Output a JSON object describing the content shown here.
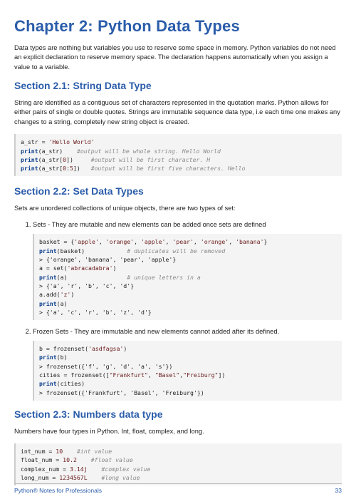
{
  "chapter_title": "Chapter 2: Python Data Types",
  "intro_text": "Data types are nothing but variables you use to reserve some space in memory. Python variables do not need an explicit declaration to reserve memory space. The declaration happens automatically when you assign a value to a variable.",
  "sections": {
    "s21": {
      "title": "Section 2.1: String Data Type",
      "text": "String are identified as a contiguous set of characters represented in the quotation marks. Python allows for either pairs of single or double quotes. Strings are immutable sequence data type, i.e each time one makes any changes to a string, completely new string object is created.",
      "code": {
        "l1a": "a_str = ",
        "l1b": "'Hello World'",
        "l2a": "print",
        "l2b": "(a_str)    ",
        "l2c": "#output will be whole string. Hello World",
        "l3a": "print",
        "l3b": "(a_str[",
        "l3c": "0",
        "l3d": "])     ",
        "l3e": "#output will be first character. H",
        "l4a": "print",
        "l4b": "(a_str[",
        "l4c": "0",
        "l4d": ":",
        "l4e": "5",
        "l4f": "])   ",
        "l4g": "#output will be first five characters. Hello"
      }
    },
    "s22": {
      "title": "Section 2.2: Set Data Types",
      "text": "Sets are unordered collections of unique objects, there are two types of set:",
      "item1_text": "Sets - They are mutable and new elements can be added once sets are defined",
      "item1_code": {
        "l1a": "basket = {",
        "l1b": "'apple'",
        "l1c": ", ",
        "l1d": "'orange'",
        "l1e": ", ",
        "l1f": "'apple'",
        "l1g": ", ",
        "l1h": "'pear'",
        "l1i": ", ",
        "l1j": "'orange'",
        "l1k": ", ",
        "l1l": "'banana'",
        "l1m": "}",
        "l2a": "print",
        "l2b": "(basket)            ",
        "l2c": "# duplicates will be removed",
        "l3": "> {'orange', 'banana', 'pear', 'apple'}",
        "l4a": "a = set(",
        "l4b": "'abracadabra'",
        "l4c": ")",
        "l5a": "print",
        "l5b": "(a)                 ",
        "l5c": "# unique letters in a",
        "l6": "> {'a', 'r', 'b', 'c', 'd'}",
        "l7a": "a.add(",
        "l7b": "'z'",
        "l7c": ")",
        "l8a": "print",
        "l8b": "(a)",
        "l9": "> {'a', 'c', 'r', 'b', 'z', 'd'}"
      },
      "item2_text": "Frozen Sets - They are immutable and new elements cannot added after its defined.",
      "item2_code": {
        "l1a": "b = frozenset(",
        "l1b": "'asdfagsa'",
        "l1c": ")",
        "l2a": "print",
        "l2b": "(b)",
        "l3": "> frozenset({'f', 'g', 'd', 'a', 's'})",
        "l4a": "cities = frozenset([",
        "l4b": "\"Frankfurt\"",
        "l4c": ", ",
        "l4d": "\"Basel\"",
        "l4e": ",",
        "l4f": "\"Freiburg\"",
        "l4g": "])",
        "l5a": "print",
        "l5b": "(cities)",
        "l6": "> frozenset({'Frankfurt', 'Basel', 'Freiburg'})"
      }
    },
    "s23": {
      "title": "Section 2.3: Numbers data type",
      "text": "Numbers have four types in Python. Int, float, complex, and long.",
      "code": {
        "l1a": "int_num = ",
        "l1b": "10",
        "l1c": "    ",
        "l1d": "#int value",
        "l2a": "float_num = ",
        "l2b": "10.2",
        "l2c": "    ",
        "l2d": "#float value",
        "l3a": "complex_num = ",
        "l3b": "3.14j",
        "l3c": "    ",
        "l3d": "#complex value",
        "l4a": "long_num = ",
        "l4b": "1234567L",
        "l4c": "    ",
        "l4d": "#long value"
      }
    }
  },
  "footer": {
    "left": "Python® Notes for Professionals",
    "right": "33"
  }
}
